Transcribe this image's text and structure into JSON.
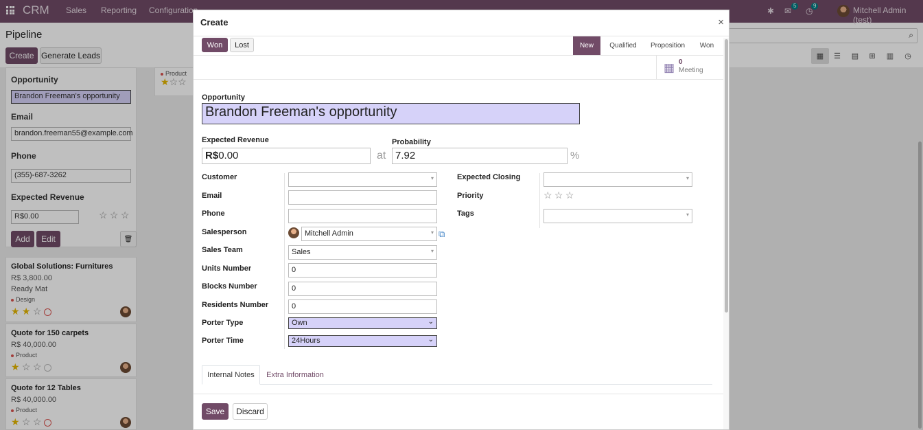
{
  "topbar": {
    "app_name": "CRM",
    "menus": [
      "Sales",
      "Reporting",
      "Configuration"
    ],
    "messages_count": "5",
    "activities_count": "9",
    "user_name": "Mitchell Admin (test)"
  },
  "control_panel": {
    "title": "Pipeline",
    "create_label": "Create",
    "generate_leads_label": "Generate Leads"
  },
  "quick_create": {
    "opportunity_label": "Opportunity",
    "opportunity_value": "Brandon Freeman's opportunity",
    "email_label": "Email",
    "email_value": "brandon.freeman55@example.com",
    "phone_label": "Phone",
    "phone_value": "(355)-687-3262",
    "revenue_label": "Expected Revenue",
    "revenue_value": "R$0.00",
    "add_label": "Add",
    "edit_label": "Edit"
  },
  "kanban": {
    "top_card_tag": "Product",
    "cards": [
      {
        "title": "Global Solutions: Furnitures",
        "amount": "R$ 3,800.00",
        "company": "Ready Mat",
        "tag": "Design"
      },
      {
        "title": "Quote for 150 carpets",
        "amount": "R$ 40,000.00",
        "company": "",
        "tag": "Product"
      },
      {
        "title": "Quote for 12 Tables",
        "amount": "R$ 40,000.00",
        "company": "",
        "tag": "Product"
      }
    ]
  },
  "dialog": {
    "title": "Create",
    "won_label": "Won",
    "lost_label": "Lost",
    "stages": [
      "New",
      "Qualified",
      "Proposition",
      "Won"
    ],
    "current_stage": "New",
    "meeting_count": "0",
    "meeting_label": "Meeting",
    "opportunity_label": "Opportunity",
    "opportunity_value": "Brandon Freeman's opportunity",
    "expected_revenue_label": "Expected Revenue",
    "currency_symbol": "R$",
    "expected_revenue_value": "0.00",
    "at_label": "at",
    "probability_label": "Probability",
    "probability_value": "7.92",
    "percent_symbol": "%",
    "left_fields": [
      {
        "label": "Customer",
        "value": ""
      },
      {
        "label": "Email",
        "value": ""
      },
      {
        "label": "Phone",
        "value": ""
      },
      {
        "label": "Salesperson",
        "value": "Mitchell Admin"
      },
      {
        "label": "Sales Team",
        "value": "Sales"
      },
      {
        "label": "Units Number",
        "value": "0"
      },
      {
        "label": "Blocks Number",
        "value": "0"
      },
      {
        "label": "Residents Number",
        "value": "0"
      },
      {
        "label": "Porter Type",
        "value": "Own"
      },
      {
        "label": "Porter Time",
        "value": "24Hours"
      }
    ],
    "right_fields": [
      {
        "label": "Expected Closing",
        "value": ""
      },
      {
        "label": "Priority",
        "value": ""
      },
      {
        "label": "Tags",
        "value": ""
      }
    ],
    "tabs": [
      "Internal Notes",
      "Extra Information"
    ],
    "save_label": "Save",
    "discard_label": "Discard"
  },
  "colors": {
    "brand": "#714b67",
    "highlight": "#d6d2f9",
    "link": "#714b67"
  }
}
